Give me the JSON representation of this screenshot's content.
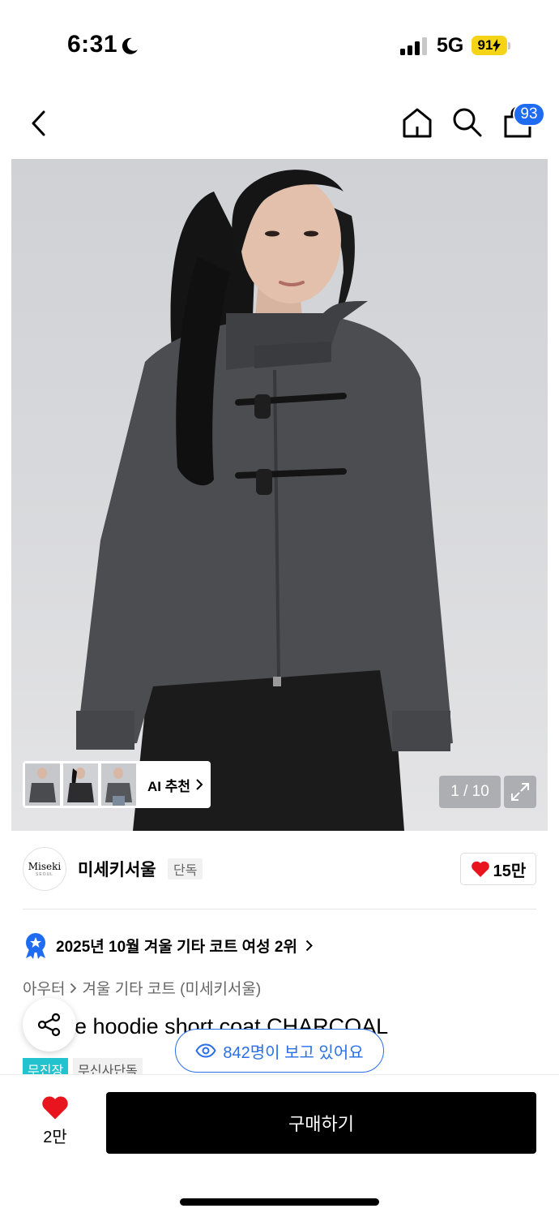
{
  "status_bar": {
    "time": "6:31",
    "network": "5G",
    "battery": "91"
  },
  "nav": {
    "cart_count": "93",
    "icons": [
      "back-icon",
      "home-icon",
      "search-icon",
      "shopping-bag-icon"
    ]
  },
  "gallery": {
    "ai_recommend_label": "AI 추천",
    "counter": "1 / 10",
    "thumbnail_count": 3
  },
  "brand": {
    "logo_text": "Miseki",
    "logo_subtext": "SEOUL",
    "name": "미세키서울",
    "tag": "단독",
    "like_count": "15만"
  },
  "ranking": {
    "text": "2025년 10월 겨울 기타 코트 여성 2위"
  },
  "breadcrumb": [
    "아우터",
    "겨울 기타 코트 (미세키서울)"
  ],
  "product": {
    "title": "e hoodie short coat CHARCOAL"
  },
  "viewers": {
    "text": "842명이 보고 있어요"
  },
  "tags": [
    "무진장",
    "무신사단독"
  ],
  "bottom_bar": {
    "like_count": "2만",
    "buy_label": "구매하기"
  },
  "colors": {
    "accent_blue": "#1f6cf2",
    "heart_red": "#e8151e",
    "tag_teal": "#22c3cf",
    "battery_yellow": "#f5d417"
  }
}
